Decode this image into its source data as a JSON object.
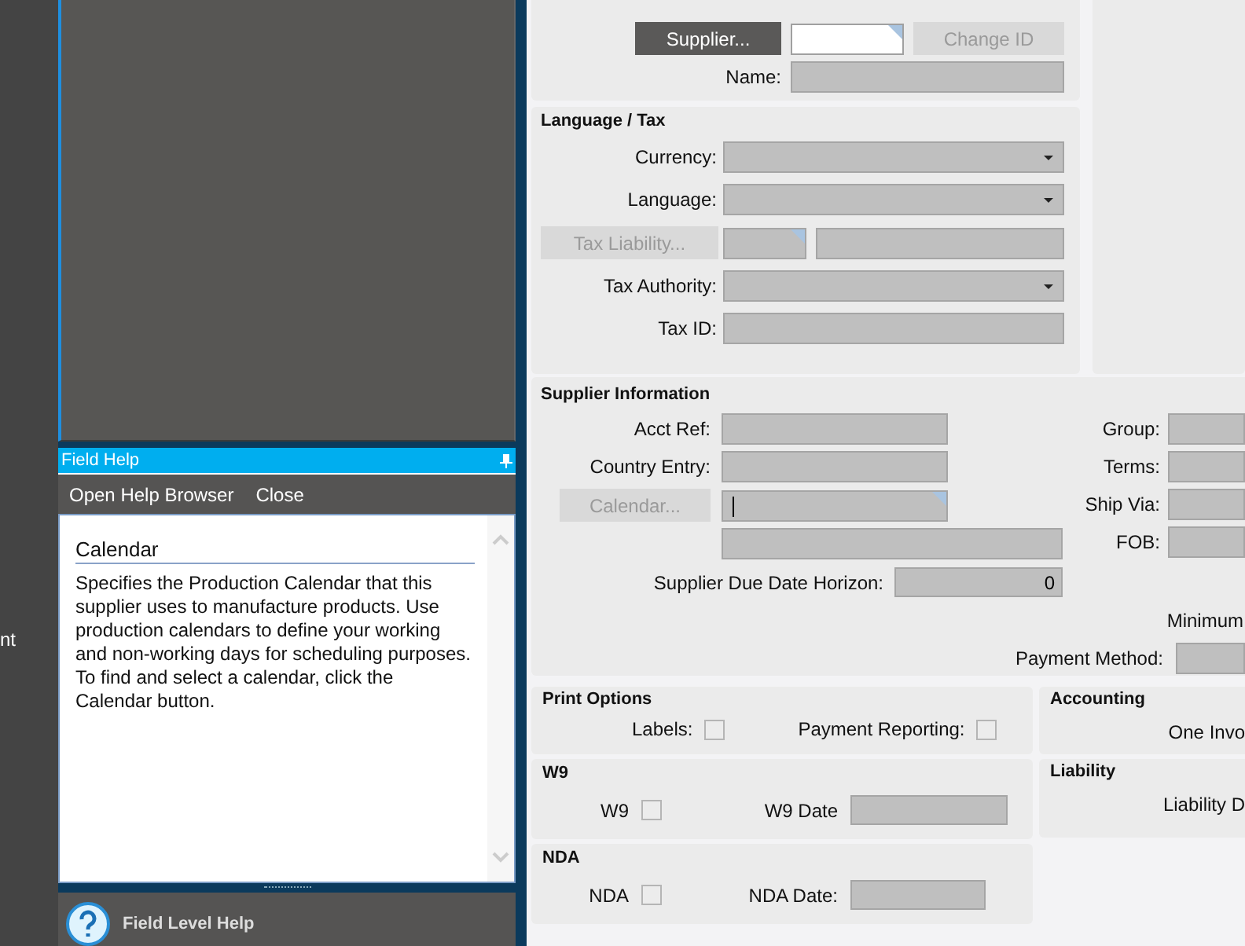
{
  "left_strip": {
    "text": "nt"
  },
  "field_help": {
    "title": "Field Help",
    "toolbar": [
      "Open Help Browser",
      "Close"
    ],
    "topic": "Calendar",
    "body": "Specifies the Production Calendar that this supplier uses to manufacture products. Use production calendars to define your working and non-working days for scheduling purposes. To find and select a calendar, click the Calendar button.",
    "footer": "Field Level Help"
  },
  "supplier": {
    "buttons": [
      {
        "label": "Supplier...",
        "disabled": false
      },
      {
        "label": "Change ID",
        "disabled": true
      }
    ],
    "name_label": "Name:"
  },
  "language_tax": {
    "title": "Language / Tax",
    "rows": [
      {
        "kind": "dropdown",
        "label": "Currency:"
      },
      {
        "kind": "dropdown",
        "label": "Language:"
      },
      {
        "kind": "lookup",
        "button": "Tax Liability...",
        "disabled": true
      },
      {
        "kind": "dropdown",
        "label": "Tax Authority:"
      },
      {
        "kind": "text",
        "label": "Tax ID:"
      }
    ]
  },
  "supplier_information": {
    "title": "Supplier Information",
    "left_rows": [
      {
        "kind": "text",
        "label": "Acct Ref:"
      },
      {
        "kind": "text",
        "label": "Country Entry:"
      },
      {
        "kind": "lookup",
        "button": "Calendar...",
        "disabled": true,
        "focused": true
      },
      {
        "kind": "wide"
      }
    ],
    "horizon": {
      "label": "Supplier Due Date Horizon:",
      "value": "0"
    },
    "right_rows": [
      {
        "label": "Group:"
      },
      {
        "label": "Terms:"
      },
      {
        "label": "Ship Via:"
      },
      {
        "label": "FOB:"
      }
    ],
    "minimum_label": "Minimum",
    "payment_method_label": "Payment Method:"
  },
  "print_options": {
    "title": "Print Options",
    "checkboxes": [
      {
        "label": "Labels:",
        "checked": false
      },
      {
        "label": "Payment Reporting:",
        "checked": false
      }
    ]
  },
  "w9": {
    "title": "W9",
    "checkbox": {
      "label": "W9",
      "checked": false
    },
    "date_label": "W9 Date"
  },
  "nda": {
    "title": "NDA",
    "checkbox": {
      "label": "NDA",
      "checked": false
    },
    "date_label": "NDA Date:"
  },
  "accounting": {
    "title": "Accounting",
    "text": "One Invo"
  },
  "liability": {
    "title": "Liability",
    "text": "Liability D"
  }
}
